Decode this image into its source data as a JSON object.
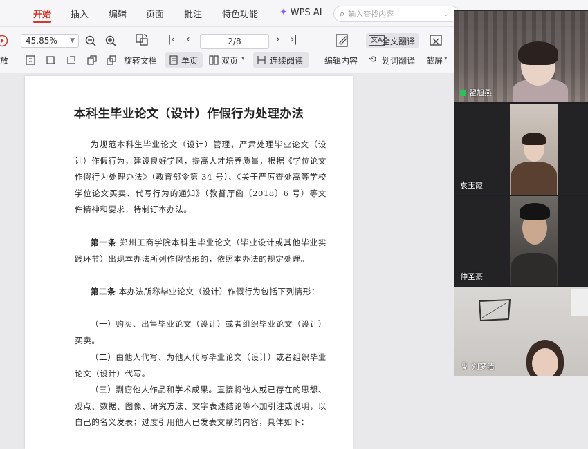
{
  "menu": {
    "tabs": [
      "开始",
      "插入",
      "编辑",
      "页面",
      "批注",
      "特色功能"
    ],
    "wps_ai": "WPS AI",
    "search_placeholder": "输入查找内容"
  },
  "toolbar": {
    "zoom": "45.85%",
    "page": "2/8",
    "left_cut_label": "放",
    "rotate_label": "旋转文档",
    "single_label": "单页",
    "double_label": "双页",
    "continuous_label": "连续阅读",
    "edit_label": "编辑内容",
    "full_translate_label": "全文翻译",
    "word_translate_label": "划词翻译",
    "screenshot_label": "截屏"
  },
  "document": {
    "title": "本科生毕业论文（设计）作假行为处理办法",
    "para1": "为规范本科生毕业论文（设计）管理，严肃处理毕业论文（设计）作假行为，建设良好学风，提高人才培养质量，根据《学位论文作假行为处理办法》（教育部令第 34 号）、《关于严厉查处高等学校学位论文买卖、代写行为的通知》（教督厅函〔2018〕6 号）等文件精神和要求，特制订本办法。",
    "art1_head": "第一条",
    "art1_body": "郑州工商学院本科生毕业论文（毕业设计或其他毕业实践环节）出现本办法所列作假情形的，依照本办法的规定处理。",
    "art2_head": "第二条",
    "art2_body": "本办法所称毕业论文（设计）作假行为包括下列情形：",
    "item1": "（一）购买、出售毕业论文（设计）或者组织毕业论文（设计）买卖。",
    "item2": "（二）由他人代写、为他人代写毕业论文（设计）或者组织毕业论文（设计）代写。",
    "item3": "（三）剽窃他人作品和学术成果。直接将他人或已存在的思想、观点、数据、图像、研究方法、文字表述结论等不加引注或说明，以自己的名义发表；过度引用他人已发表文献的内容，具体如下："
  },
  "participants": [
    {
      "name": "翟旭燕",
      "mic": "on"
    },
    {
      "name": "袁玉霞",
      "mic": "off"
    },
    {
      "name": "仲圣豪",
      "mic": "off"
    },
    {
      "name": "刘梦洁",
      "mic": "off"
    }
  ]
}
